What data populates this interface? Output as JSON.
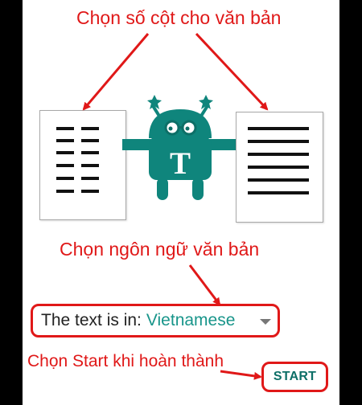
{
  "annotations": {
    "choose_columns": "Chọn số cột cho văn bản",
    "choose_language": "Chọn ngôn ngữ văn bản",
    "choose_start": "Chọn Start khi hoàn thành"
  },
  "language": {
    "label": "The text is in:",
    "value": "Vietnamese"
  },
  "buttons": {
    "start": "START"
  },
  "robot": {
    "letter": "T"
  },
  "colors": {
    "annotation": "#e01818",
    "accent": "#18958a",
    "robot": "#0f857c",
    "start_text": "#0d6f67"
  },
  "icons": {
    "robot": "android-robot-icon",
    "multi_column_document": "multi-column-document-icon",
    "single_column_document": "single-column-document-icon",
    "dropdown": "dropdown-arrow-icon"
  }
}
